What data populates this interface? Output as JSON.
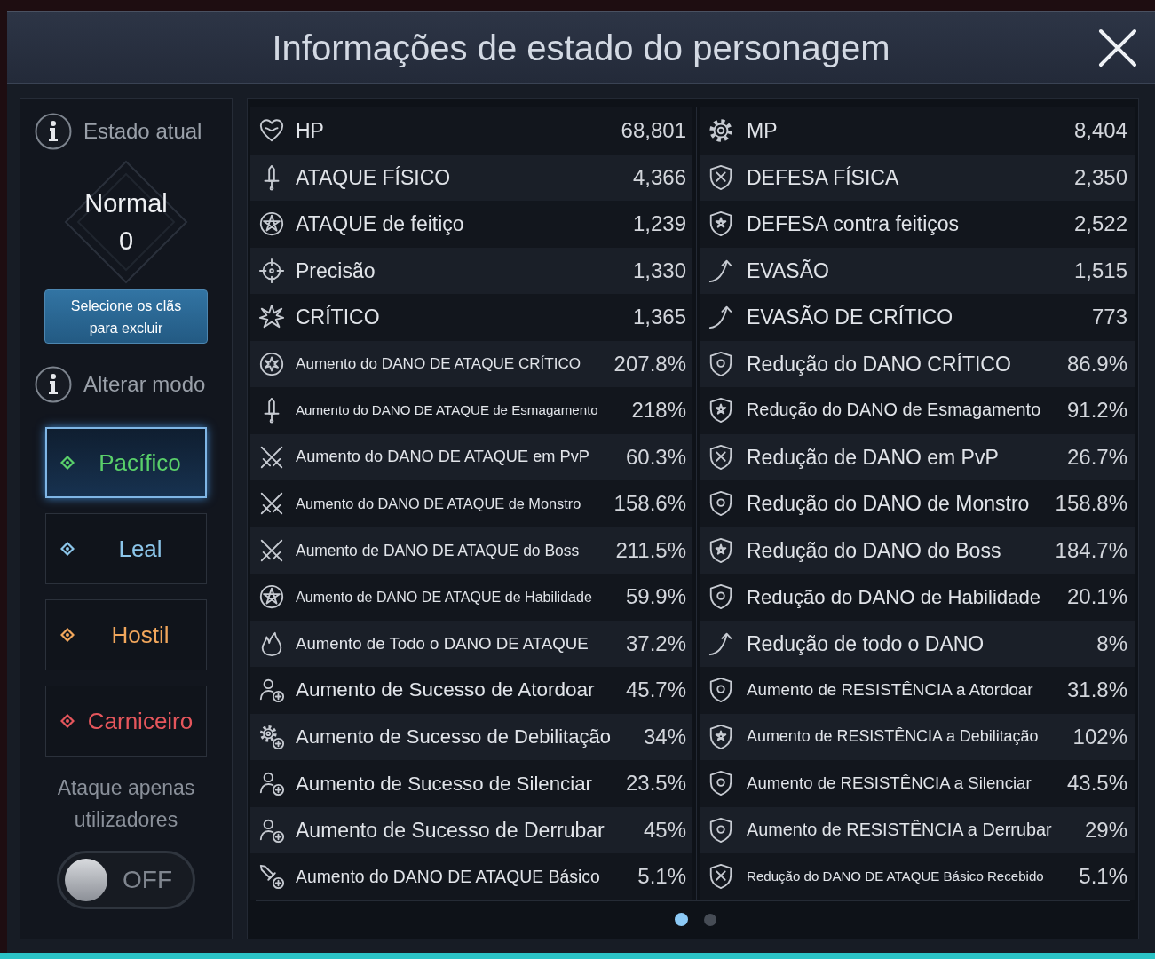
{
  "window": {
    "title": "Informações de estado do personagem"
  },
  "current_state": {
    "heading": "Estado atual",
    "state": "Normal",
    "value": "0",
    "exclude_clans_button": "Selecione os clãs para excluir"
  },
  "mode": {
    "heading": "Alterar modo",
    "options": [
      {
        "label": "Pacífico",
        "color": "#5ad06a",
        "selected": true
      },
      {
        "label": "Leal",
        "color": "#8cc6ea",
        "selected": false
      },
      {
        "label": "Hostil",
        "color": "#f2a75c",
        "selected": false
      },
      {
        "label": "Carniceiro",
        "color": "#e5565c",
        "selected": false
      }
    ]
  },
  "attack_users_only": {
    "label": "Ataque apenas utilizadores",
    "toggle_text": "OFF",
    "on": false
  },
  "stats_left": [
    {
      "label": "HP",
      "value": "68,801"
    },
    {
      "label": "ATAQUE FÍSICO",
      "value": "4,366"
    },
    {
      "label": "ATAQUE de feitiço",
      "value": "1,239"
    },
    {
      "label": "Precisão",
      "value": "1,330"
    },
    {
      "label": "CRÍTICO",
      "value": "1,365"
    },
    {
      "label": "Aumento do DANO DE ATAQUE CRÍTICO",
      "value": "207.8%"
    },
    {
      "label": "Aumento do DANO DE ATAQUE de Esmagamento",
      "value": "218%"
    },
    {
      "label": "Aumento do DANO DE ATAQUE em PvP",
      "value": "60.3%"
    },
    {
      "label": "Aumento do DANO DE ATAQUE de Monstro",
      "value": "158.6%"
    },
    {
      "label": "Aumento de DANO DE ATAQUE do Boss",
      "value": "211.5%"
    },
    {
      "label": "Aumento de DANO DE ATAQUE de Habilidade",
      "value": "59.9%"
    },
    {
      "label": "Aumento de Todo o DANO DE ATAQUE",
      "value": "37.2%"
    },
    {
      "label": "Aumento de Sucesso de Atordoar",
      "value": "45.7%"
    },
    {
      "label": "Aumento de Sucesso de Debilitação",
      "value": "34%"
    },
    {
      "label": "Aumento de Sucesso de Silenciar",
      "value": "23.5%"
    },
    {
      "label": "Aumento de Sucesso de Derrubar",
      "value": "45%"
    },
    {
      "label": "Aumento do DANO DE ATAQUE Básico",
      "value": "5.1%"
    }
  ],
  "stats_right": [
    {
      "label": "MP",
      "value": "8,404"
    },
    {
      "label": "DEFESA FÍSICA",
      "value": "2,350"
    },
    {
      "label": "DEFESA contra feitiços",
      "value": "2,522"
    },
    {
      "label": "EVASÃO",
      "value": "1,515"
    },
    {
      "label": "EVASÃO DE CRÍTICO",
      "value": "773"
    },
    {
      "label": "Redução do DANO CRÍTICO",
      "value": "86.9%"
    },
    {
      "label": "Redução do DANO de Esmagamento",
      "value": "91.2%"
    },
    {
      "label": "Redução de DANO em PvP",
      "value": "26.7%"
    },
    {
      "label": "Redução do DANO de Monstro",
      "value": "158.8%"
    },
    {
      "label": "Redução do DANO do Boss",
      "value": "184.7%"
    },
    {
      "label": "Redução do DANO de Habilidade",
      "value": "20.1%"
    },
    {
      "label": "Redução de todo o DANO",
      "value": "8%"
    },
    {
      "label": "Aumento de RESISTÊNCIA a Atordoar",
      "value": "31.8%"
    },
    {
      "label": "Aumento de RESISTÊNCIA a Debilitação",
      "value": "102%"
    },
    {
      "label": "Aumento de RESISTÊNCIA a Silenciar",
      "value": "43.5%"
    },
    {
      "label": "Aumento de RESISTÊNCIA a Derrubar",
      "value": "29%"
    },
    {
      "label": "Redução do DANO DE ATAQUE Básico Recebido",
      "value": "5.1%"
    }
  ],
  "pagination": [
    {
      "selected": true
    },
    {
      "selected": false
    }
  ]
}
